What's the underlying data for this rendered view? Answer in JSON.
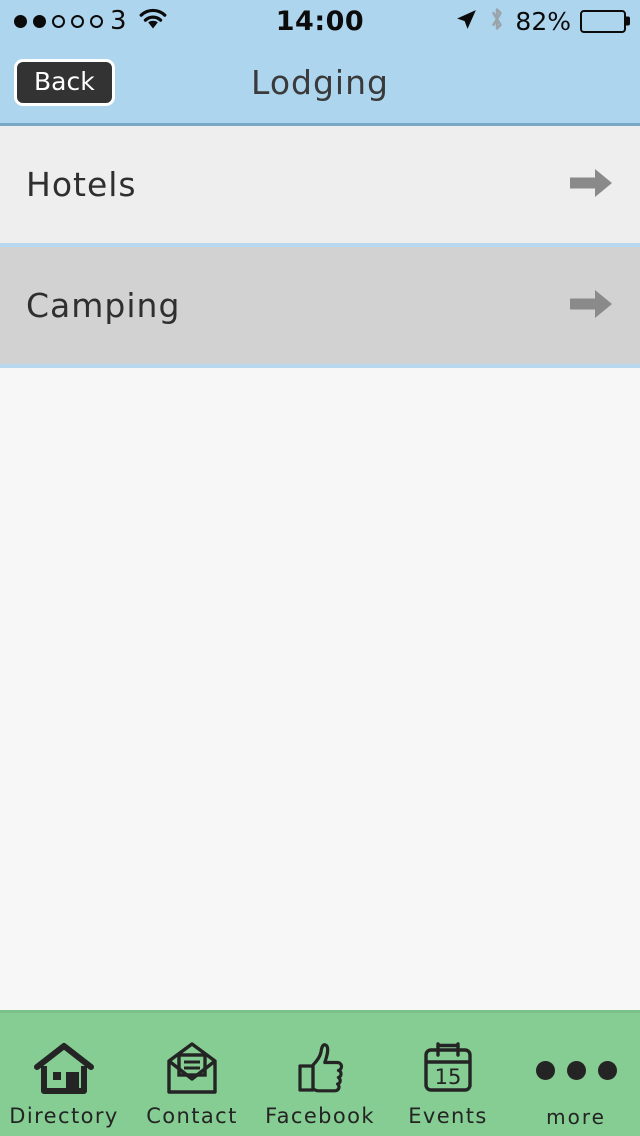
{
  "statusbar": {
    "signal_dots_filled": 2,
    "signal_dots_total": 5,
    "carrier": "3",
    "wifi_icon": "wifi-icon",
    "time": "14:00",
    "location_icon": "location-arrow-icon",
    "bluetooth_icon": "bluetooth-icon",
    "battery_percent": "82%",
    "battery_icon": "battery-icon"
  },
  "navbar": {
    "back_label": "Back",
    "title": "Lodging",
    "background": "#aed5ee",
    "border": "#7ba7c7"
  },
  "list": {
    "rows": [
      {
        "label": "Hotels",
        "state": "plain",
        "background": "#eeeeee",
        "arrow_icon": "arrow-right-icon"
      },
      {
        "label": "Camping",
        "state": "selected",
        "background": "#d2d2d2",
        "arrow_icon": "arrow-right-icon"
      }
    ],
    "separator_color": "#b8d8ef",
    "arrow_color": "#8a8a8a"
  },
  "content": {
    "background": "#f7f7f7"
  },
  "tabbar": {
    "background": "#85cd92",
    "items": [
      {
        "label": "Directory",
        "icon": "house-icon"
      },
      {
        "label": "Contact",
        "icon": "envelope-icon"
      },
      {
        "label": "Facebook",
        "icon": "thumbs-up-icon"
      },
      {
        "label": "Events",
        "icon": "calendar-icon",
        "badge": "15"
      },
      {
        "label": "more",
        "icon": "ellipsis-icon"
      }
    ]
  }
}
